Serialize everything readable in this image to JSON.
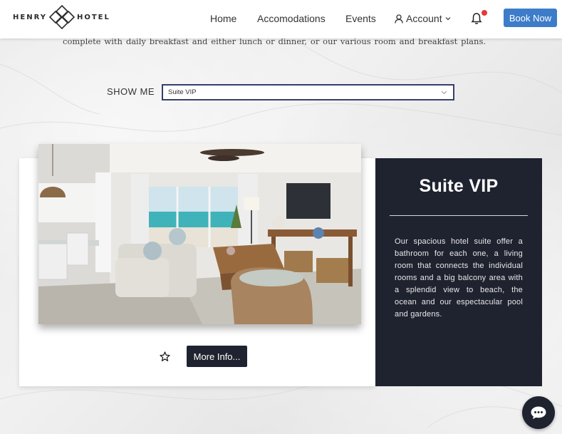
{
  "brand": {
    "name_left": "HENRY",
    "name_right": "HOTEL",
    "logo_icon": "diamond-lattice-logo"
  },
  "nav": {
    "home": "Home",
    "accomodations": "Accomodations",
    "events": "Events",
    "account": "Account",
    "book_now": "Book Now"
  },
  "intro_text": "complete with daily breakfast and either lunch or dinner, or our various room and breakfast plans.",
  "filter": {
    "label": "SHOW ME",
    "selected": "Suite VIP"
  },
  "room": {
    "title": "Suite VIP",
    "description": "Our spacious hotel suite offer a bathroom for each one, a living room that connects the individual rooms and a big balcony area with a splendid view to beach, the ocean and our espectacular pool and gardens.",
    "more_info": "More Info..."
  },
  "colors": {
    "accent": "#3d7cc9",
    "dark": "#1f2330",
    "notification": "#e53935"
  }
}
